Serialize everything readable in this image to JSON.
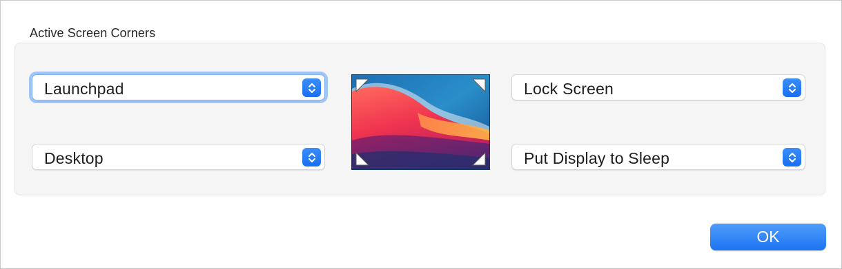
{
  "section": {
    "title": "Active Screen Corners"
  },
  "corners": {
    "top_left": {
      "selected": "Launchpad"
    },
    "bottom_left": {
      "selected": "Desktop"
    },
    "top_right": {
      "selected": "Lock Screen"
    },
    "bottom_right": {
      "selected": "Put Display to Sleep"
    }
  },
  "buttons": {
    "ok_label": "OK"
  },
  "icons": {
    "popup_stepper": "chevron-up-down-icon",
    "corner_marker": "corner-triangle-icon"
  },
  "colors": {
    "accent": "#1a6ff3",
    "focus_ring": "#9fc4f7"
  }
}
